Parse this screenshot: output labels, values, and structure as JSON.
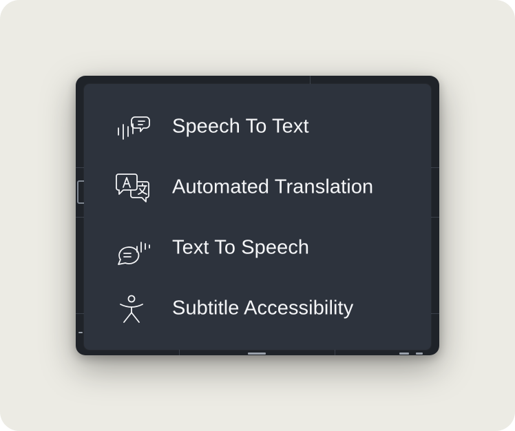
{
  "menu": {
    "items": [
      {
        "label": "Speech To Text",
        "icon": "speech-to-text-icon"
      },
      {
        "label": "Automated Translation",
        "icon": "translate-icon"
      },
      {
        "label": "Text To Speech",
        "icon": "text-to-speech-icon"
      },
      {
        "label": "Subtitle Accessibility",
        "icon": "accessibility-icon"
      }
    ]
  },
  "colors": {
    "outer_background": "#ecebe4",
    "menu_background": "#2d333d",
    "backdrop": "#1f2329",
    "text": "#f4f5f7"
  }
}
